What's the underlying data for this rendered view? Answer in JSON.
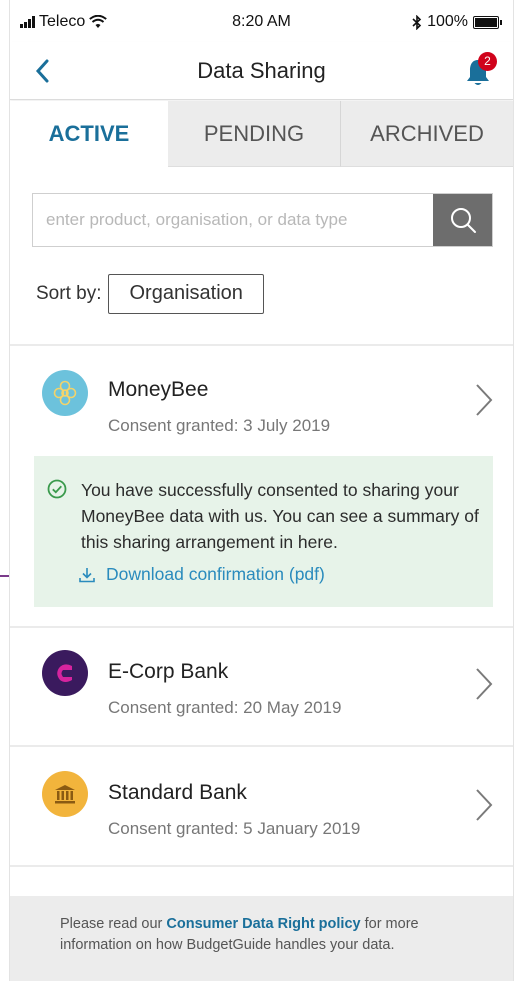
{
  "status_bar": {
    "carrier": "Teleco",
    "time": "8:20 AM",
    "battery": "100%"
  },
  "nav": {
    "title": "Data Sharing",
    "notification_count": "2"
  },
  "tabs": [
    {
      "label": "ACTIVE",
      "selected": true
    },
    {
      "label": "PENDING",
      "selected": false
    },
    {
      "label": "ARCHIVED",
      "selected": false
    }
  ],
  "search": {
    "placeholder": "enter product, organisation, or data type",
    "value": ""
  },
  "sort": {
    "label": "Sort by:",
    "value": "Organisation"
  },
  "items": [
    {
      "name": "MoneyBee",
      "consent": "Consent granted: 3 July 2019",
      "logo_color": "#6cc2dc"
    },
    {
      "name": "E-Corp Bank",
      "consent": "Consent granted: 20 May 2019",
      "logo_color": "#3a1a5e"
    },
    {
      "name": "Standard Bank",
      "consent": "Consent granted: 5 January 2019",
      "logo_color": "#f2b43c"
    }
  ],
  "success_message": {
    "text": "You have successfully consented to sharing your MoneyBee data with us. You can see a summary of this sharing arrangement in here.",
    "link": "Download confirmation (pdf)"
  },
  "footer": {
    "prefix": "Please read our ",
    "link": "Consumer Data Right policy",
    "suffix": " for more information on how BudgetGuide handles your data."
  },
  "colors": {
    "accent": "#1a6f9a",
    "link": "#2a8bbd",
    "success_bg": "#e7f3e9",
    "badge": "#d0021b"
  }
}
